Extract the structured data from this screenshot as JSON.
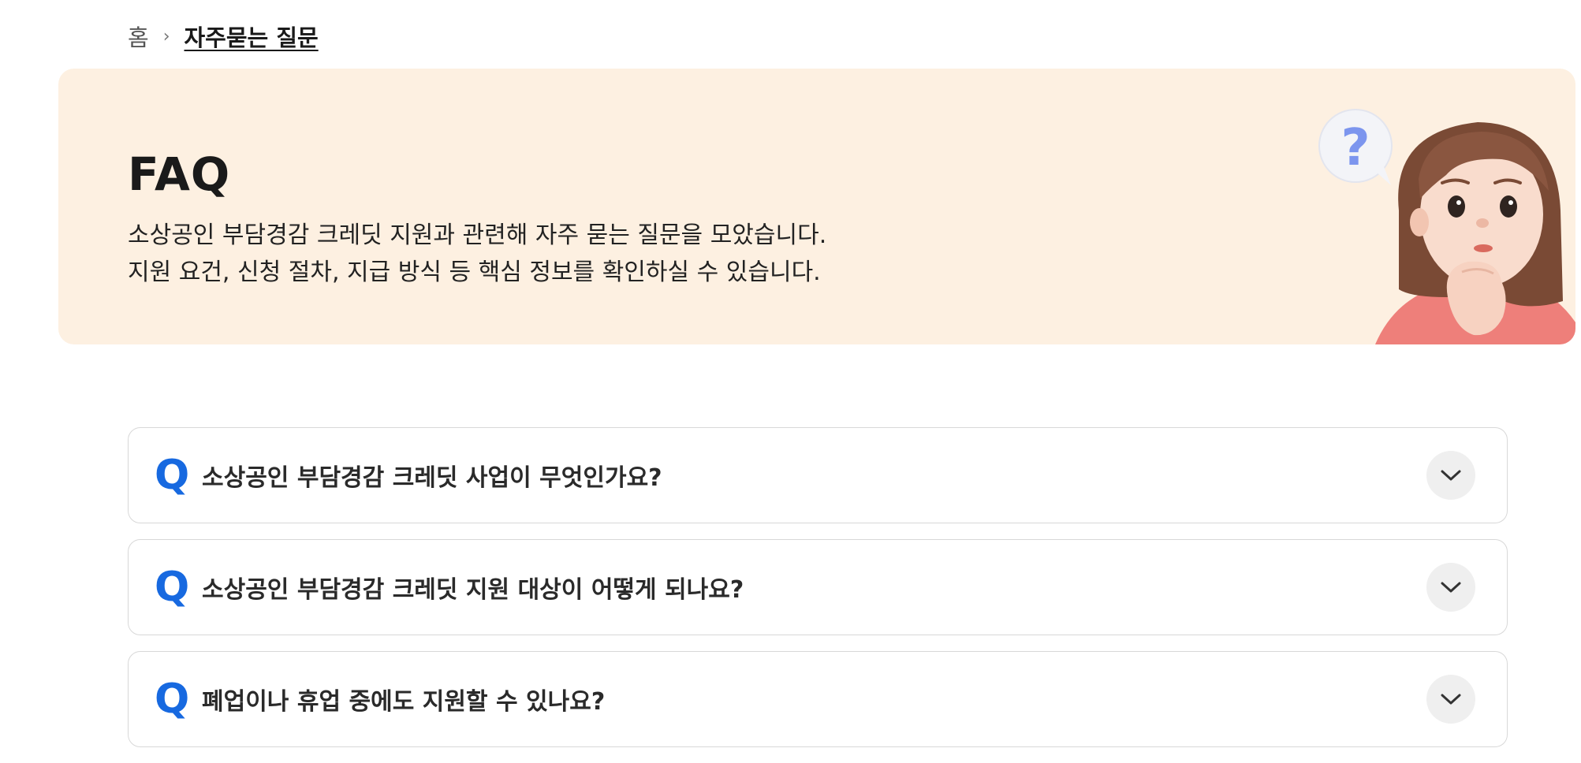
{
  "breadcrumb": {
    "home": "홈",
    "separator": "›",
    "current": "자주묻는 질문"
  },
  "hero": {
    "title": "FAQ",
    "desc_line1": "소상공인 부담경감 크레딧 지원과 관련해 자주 묻는 질문을 모았습니다.",
    "desc_line2": "지원 요건, 신청 절차, 지급 방식 등 핵심 정보를 확인하실 수 있습니다.",
    "illustration": "thinking-woman-question-mark",
    "bg_color": "#fdf0e1"
  },
  "faq": {
    "q_marker": "Q",
    "accent_color": "#1769e0",
    "items": [
      {
        "question": "소상공인 부담경감 크레딧 사업이 무엇인가요?"
      },
      {
        "question": "소상공인 부담경감 크레딧 지원 대상이 어떻게 되나요?"
      },
      {
        "question": "폐업이나 휴업 중에도 지원할 수 있나요?"
      }
    ],
    "toggle_icon": "chevron-down-icon"
  }
}
